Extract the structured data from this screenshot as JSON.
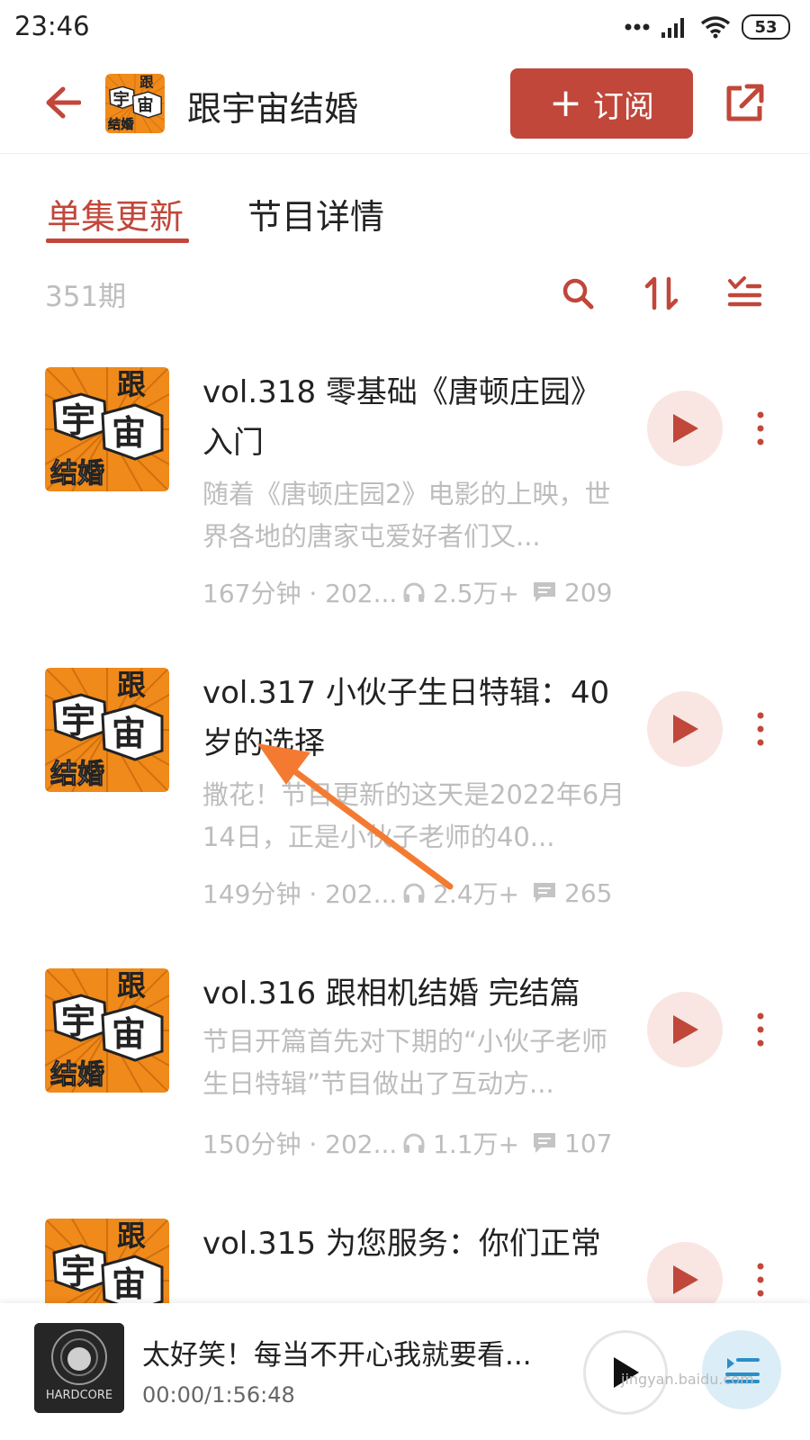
{
  "status_bar": {
    "time": "23:46",
    "battery": "53"
  },
  "header": {
    "title": "跟宇宙结婚",
    "subscribe_label": "订阅",
    "subscribe_plus": "+",
    "cover_text": [
      "跟",
      "宇",
      "宙",
      "结婚"
    ]
  },
  "tabs": [
    {
      "label": "单集更新",
      "active": true
    },
    {
      "label": "节目详情",
      "active": false
    }
  ],
  "list_toolbar": {
    "count": "351期",
    "icons": [
      "search-icon",
      "sort-icon",
      "filter-list-icon"
    ]
  },
  "episodes": [
    {
      "title": "vol.318 零基础《唐顿庄园》入门",
      "desc": "随着《唐顿庄园2》电影的上映，世界各地的唐家屯爱好者们又...",
      "duration": "167分钟 · 202...",
      "plays": "2.5万+",
      "comments": "209"
    },
    {
      "title": "vol.317 小伙子生日特辑：40岁的选择",
      "desc": "撒花！节目更新的这天是2022年6月14日，正是小伙子老师的40...",
      "duration": "149分钟 · 202...",
      "plays": "2.4万+",
      "comments": "265"
    },
    {
      "title": "vol.316 跟相机结婚 完结篇",
      "desc": "节目开篇首先对下期的“小伙子老师生日特辑”节目做出了互动方...",
      "duration": "150分钟 · 202...",
      "plays": "1.1万+",
      "comments": "107"
    },
    {
      "title": "vol.315 为您服务：你们正常",
      "desc": "",
      "duration": "",
      "plays": "",
      "comments": ""
    }
  ],
  "player": {
    "title": "太好笑！每当不开心我就要看...",
    "time": "00:00/1:56:48",
    "cover_text": "HARDCORE",
    "watermark": "jingyan.baidu.com"
  },
  "colors": {
    "accent": "#c0473a",
    "play_bg": "#f9e6e3",
    "muted_text": "#bdbdbd",
    "cover_orange": "#f08a1a",
    "annotation_arrow": "#f47a32"
  }
}
